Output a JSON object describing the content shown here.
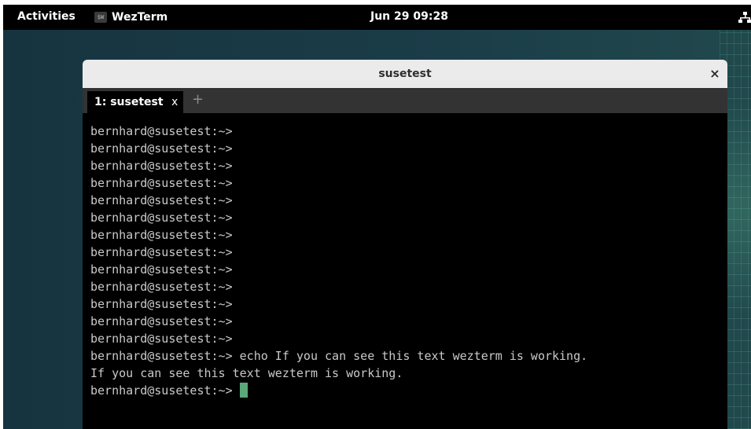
{
  "topbar": {
    "activities_label": "Activities",
    "app_name": "WezTerm",
    "app_icon_text": "$W",
    "clock": "Jun 29  09:28"
  },
  "window": {
    "title": "susetest",
    "close_glyph": "×",
    "tabs": [
      {
        "label": "1: susetest",
        "close_glyph": "x",
        "active": true
      }
    ],
    "new_tab_glyph": "+"
  },
  "terminal": {
    "lines": [
      "bernhard@susetest:~>",
      "bernhard@susetest:~>",
      "bernhard@susetest:~>",
      "bernhard@susetest:~>",
      "bernhard@susetest:~>",
      "bernhard@susetest:~>",
      "bernhard@susetest:~>",
      "bernhard@susetest:~>",
      "bernhard@susetest:~>",
      "bernhard@susetest:~>",
      "bernhard@susetest:~>",
      "bernhard@susetest:~>",
      "bernhard@susetest:~>",
      "bernhard@susetest:~> echo If you can see this text wezterm is working.",
      "If you can see this text wezterm is working."
    ],
    "prompt": "bernhard@susetest:~>",
    "cursor_color": "#5aa87a",
    "text_color": "#c9c9c9",
    "background": "#000000"
  }
}
